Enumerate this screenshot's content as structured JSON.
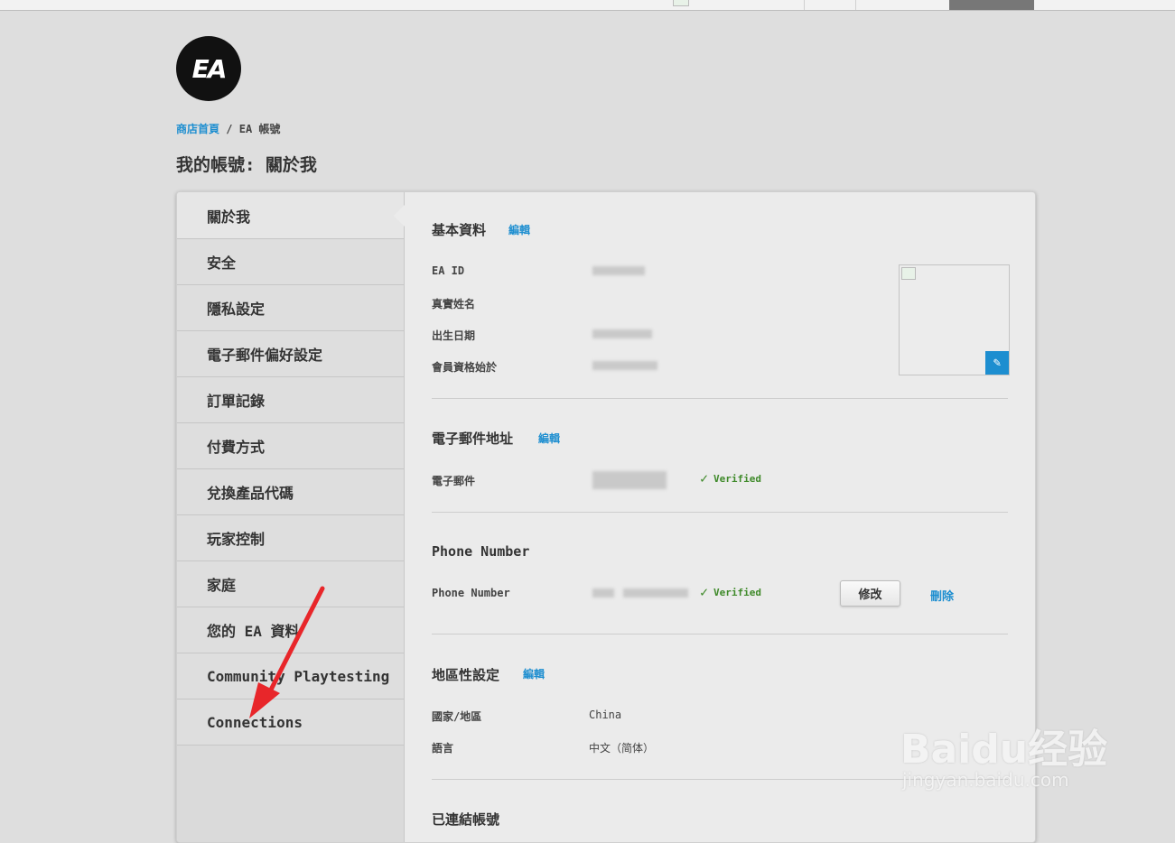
{
  "breadcrumb": {
    "home": "商店首頁",
    "separator": "/",
    "current": "EA 帳號"
  },
  "page": {
    "title": "我的帳號: 關於我"
  },
  "logo": {
    "text": "EA"
  },
  "sidebar": {
    "items": [
      {
        "label": "關於我",
        "active": true
      },
      {
        "label": "安全"
      },
      {
        "label": "隱私設定"
      },
      {
        "label": "電子郵件偏好設定"
      },
      {
        "label": "訂單記錄"
      },
      {
        "label": "付費方式"
      },
      {
        "label": "兌換產品代碼"
      },
      {
        "label": "玩家控制"
      },
      {
        "label": "家庭"
      },
      {
        "label": "您的 EA 資料"
      },
      {
        "label": "Community Playtesting"
      },
      {
        "label": "Connections"
      }
    ]
  },
  "basic_info": {
    "title": "基本資料",
    "edit": "編輯",
    "fields": [
      {
        "label": "EA ID"
      },
      {
        "label": "真實姓名"
      },
      {
        "label": "出生日期"
      },
      {
        "label": "會員資格始於"
      }
    ]
  },
  "email": {
    "title": "電子郵件地址",
    "edit": "編輯",
    "field_label": "電子郵件",
    "verified": "Verified"
  },
  "phone": {
    "title": "Phone Number",
    "field_label": "Phone Number",
    "verified": "Verified",
    "modify": "修改",
    "delete": "刪除"
  },
  "regional": {
    "title": "地區性設定",
    "edit": "編輯",
    "country_label": "國家/地區",
    "country_value": "China",
    "language_label": "語言",
    "language_value": "中文（简体）"
  },
  "linked_accounts": {
    "title": "已連結帳號"
  },
  "watermark": {
    "brand": "Baidu经验",
    "url": "jingyan.baidu.com"
  },
  "colors": {
    "link": "#1d8ed0",
    "verified": "#3f8a2a",
    "arrow": "#e8262a",
    "background": "#dedede"
  }
}
